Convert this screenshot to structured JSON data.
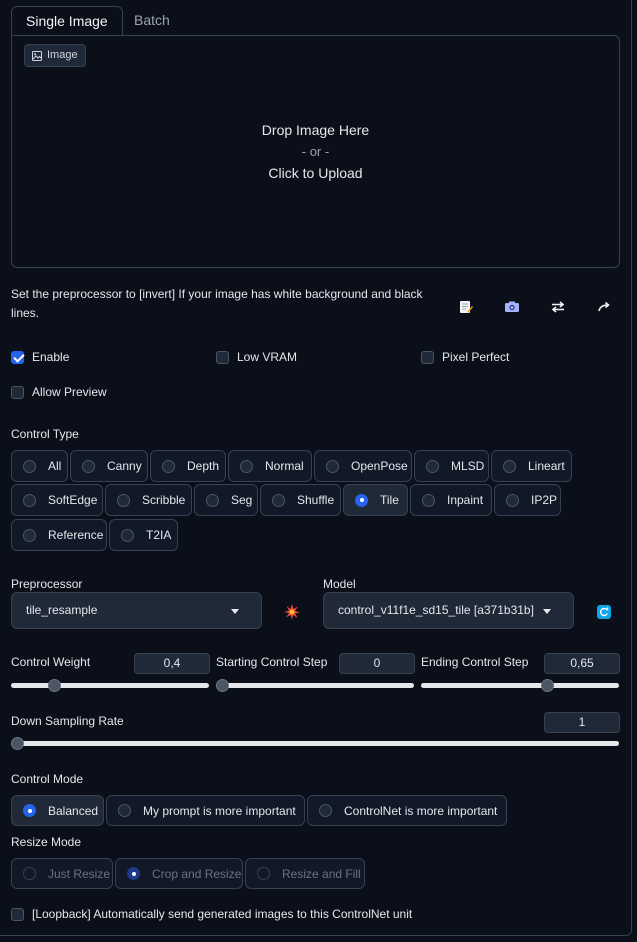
{
  "tabs": [
    {
      "label": "Single Image",
      "active": true
    },
    {
      "label": "Batch",
      "active": false
    }
  ],
  "upload": {
    "badge": "Image",
    "line1": "Drop Image Here",
    "line2": "- or -",
    "line3": "Click to Upload"
  },
  "hint": "Set the preprocessor to [invert] If your image has white background and black lines.",
  "tool_icons": [
    "edit-canvas-icon",
    "camera-icon",
    "swap-arrows-icon",
    "send-dimensions-icon"
  ],
  "options": {
    "enable": {
      "label": "Enable",
      "checked": true
    },
    "low_vram": {
      "label": "Low VRAM",
      "checked": false
    },
    "pixel_perfect": {
      "label": "Pixel Perfect",
      "checked": false
    },
    "allow_preview": {
      "label": "Allow Preview",
      "checked": false
    }
  },
  "control_type": {
    "label": "Control Type",
    "items": [
      "All",
      "Canny",
      "Depth",
      "Normal",
      "OpenPose",
      "MLSD",
      "Lineart",
      "SoftEdge",
      "Scribble",
      "Seg",
      "Shuffle",
      "Tile",
      "Inpaint",
      "IP2P",
      "Reference",
      "T2IA"
    ],
    "selected": "Tile"
  },
  "preprocessor": {
    "label": "Preprocessor",
    "value": "tile_resample"
  },
  "model": {
    "label": "Model",
    "value": "control_v11f1e_sd15_tile [a371b31b]"
  },
  "sliders": {
    "control_weight": {
      "label": "Control Weight",
      "value": "0,4",
      "fraction": 0.2
    },
    "start_step": {
      "label": "Starting Control Step",
      "value": "0",
      "fraction": 0.0
    },
    "end_step": {
      "label": "Ending Control Step",
      "value": "0,65",
      "fraction": 0.65
    },
    "down_sampling": {
      "label": "Down Sampling Rate",
      "value": "1",
      "fraction": 0.0
    }
  },
  "control_mode": {
    "label": "Control Mode",
    "items": [
      "Balanced",
      "My prompt is more important",
      "ControlNet is more important"
    ],
    "selected": "Balanced"
  },
  "resize_mode": {
    "label": "Resize Mode",
    "items": [
      "Just Resize",
      "Crop and Resize",
      "Resize and Fill"
    ],
    "selected": "Crop and Resize"
  },
  "loopback": {
    "label": "[Loopback] Automatically send generated images to this ControlNet unit",
    "checked": false
  },
  "colors": {
    "accent": "#2563eb",
    "background": "#0b0f19",
    "border": "#374151"
  }
}
